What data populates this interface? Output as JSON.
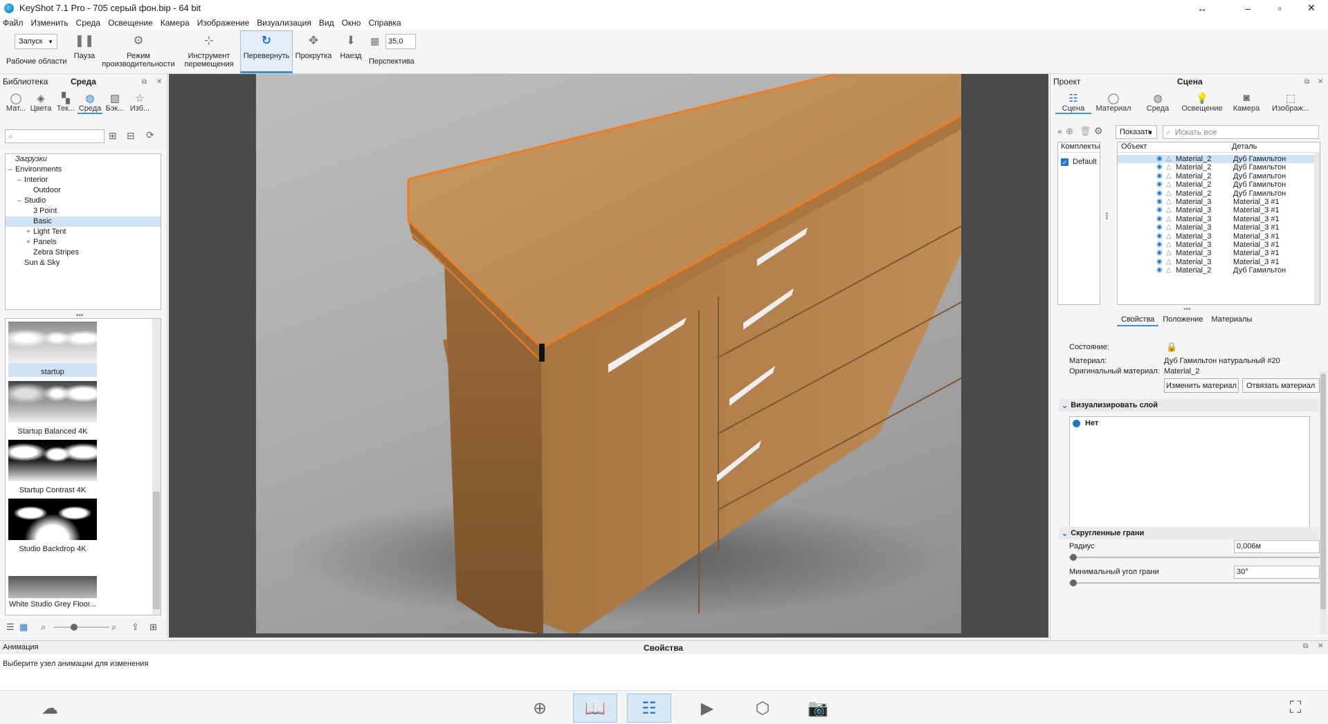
{
  "window": {
    "title": "KeyShot 7.1 Pro  - 705 серый фон.bip  - 64 bit",
    "controls": [
      "↔",
      "–",
      "▫",
      "✕"
    ]
  },
  "menu": [
    "Файл",
    "Изменить",
    "Среда",
    "Освещение",
    "Камера",
    "Изображение",
    "Визуализация",
    "Вид",
    "Окно",
    "Справка"
  ],
  "toolbar": {
    "workspace_value": "Запуск",
    "workspace_label": "Рабочие области",
    "pause": "Пауза",
    "perf_l1": "Режим",
    "perf_l2": "производительности",
    "move_l1": "Инструмент",
    "move_l2": "перемещения",
    "flip": "Перевернуть",
    "pan": "Прокрутка",
    "dolly": "Наезд",
    "fov_value": "35,0",
    "perspective": "Перспектива"
  },
  "library": {
    "header": "Библиотека",
    "active_title": "Среда",
    "tabs": [
      {
        "label": "Мат...",
        "icon": "material-icon"
      },
      {
        "label": "Цвета",
        "icon": "colors-icon"
      },
      {
        "label": "Тек...",
        "icon": "textures-icon"
      },
      {
        "label": "Среда",
        "icon": "environment-icon"
      },
      {
        "label": "Бэк...",
        "icon": "backplates-icon"
      },
      {
        "label": "Изб...",
        "icon": "favorites-icon"
      }
    ],
    "tree": [
      {
        "label": "Загрузки",
        "level": 0,
        "italic": true
      },
      {
        "label": "Environments",
        "level": 0,
        "exp": "–"
      },
      {
        "label": "Interior",
        "level": 1,
        "exp": "–"
      },
      {
        "label": "Outdoor",
        "level": 2
      },
      {
        "label": "Studio",
        "level": 1,
        "exp": "–"
      },
      {
        "label": "3 Point",
        "level": 2
      },
      {
        "label": "Basic",
        "level": 2,
        "selected": true
      },
      {
        "label": "Light Tent",
        "level": 2,
        "exp": "+"
      },
      {
        "label": "Panels",
        "level": 2,
        "exp": "+"
      },
      {
        "label": "Zebra Stripes",
        "level": 2
      },
      {
        "label": "Sun & Sky",
        "level": 1
      }
    ],
    "thumbnails": [
      {
        "caption": "startup",
        "selected": true
      },
      {
        "caption": "Startup Balanced 4K"
      },
      {
        "caption": "Startup Contrast 4K"
      },
      {
        "caption": "Studio Backdrop 4K"
      },
      {
        "caption": "White Studio Grey Floor..."
      }
    ]
  },
  "project": {
    "header": "Проект",
    "active_title": "Сцена",
    "tabs": [
      {
        "label": "Сцена",
        "icon": "scene-icon"
      },
      {
        "label": "Материал",
        "icon": "material-icon"
      },
      {
        "label": "Среда",
        "icon": "environment-icon"
      },
      {
        "label": "Освещение",
        "icon": "lighting-icon"
      },
      {
        "label": "Камера",
        "icon": "camera-icon"
      },
      {
        "label": "Изображ...",
        "icon": "image-icon"
      }
    ],
    "show_button": "Показать",
    "search_placeholder": "Искать все",
    "sets_header": "Комплекты м",
    "set_default": "Default",
    "col_object": "Объект",
    "col_detail": "Деталь",
    "rows": [
      {
        "object": "Material_2",
        "detail": "Дуб Гамильтон",
        "selected": true
      },
      {
        "object": "Material_2",
        "detail": "Дуб Гамильтон"
      },
      {
        "object": "Material_2",
        "detail": "Дуб Гамильтон"
      },
      {
        "object": "Material_2",
        "detail": "Дуб Гамильтон"
      },
      {
        "object": "Material_2",
        "detail": "Дуб Гамильтон"
      },
      {
        "object": "Material_3",
        "detail": "Material_3 #1"
      },
      {
        "object": "Material_3",
        "detail": "Material_3 #1"
      },
      {
        "object": "Material_3",
        "detail": "Material_3 #1"
      },
      {
        "object": "Material_3",
        "detail": "Material_3 #1"
      },
      {
        "object": "Material_3",
        "detail": "Material_3 #1"
      },
      {
        "object": "Material_3",
        "detail": "Material_3 #1"
      },
      {
        "object": "Material_3",
        "detail": "Material_3 #1"
      },
      {
        "object": "Material_3",
        "detail": "Material_3 #1"
      },
      {
        "object": "Material_2",
        "detail": "Дуб Гамильтон"
      }
    ],
    "sub_tabs": [
      "Свойства",
      "Положение",
      "Материалы"
    ],
    "props": {
      "state_label": "Состояние:",
      "material_label": "Материал:",
      "material_value": "Дуб Гамильтон натуральный #20",
      "orig_label": "Оригинальный материал:",
      "orig_value": "Material_2",
      "change_btn": "Изменить материал",
      "unlink_btn": "Отвязать материал"
    },
    "render_layer": {
      "title": "Визуализировать слой",
      "option": "Нет"
    },
    "rounded": {
      "title": "Скругленные грани",
      "radius_label": "Радиус",
      "radius_value": "0,006м",
      "angle_label": "Минимальный угол грани",
      "angle_value": "30°"
    }
  },
  "animation": {
    "header": "Анимация",
    "center_title": "Свойства",
    "hint": "Выберите узел анимации для изменения"
  },
  "colors": {
    "accent": "#3b8ddb",
    "selection": "#cfe3f7",
    "outline": "#f07c1c",
    "wood": "#b47d45"
  }
}
